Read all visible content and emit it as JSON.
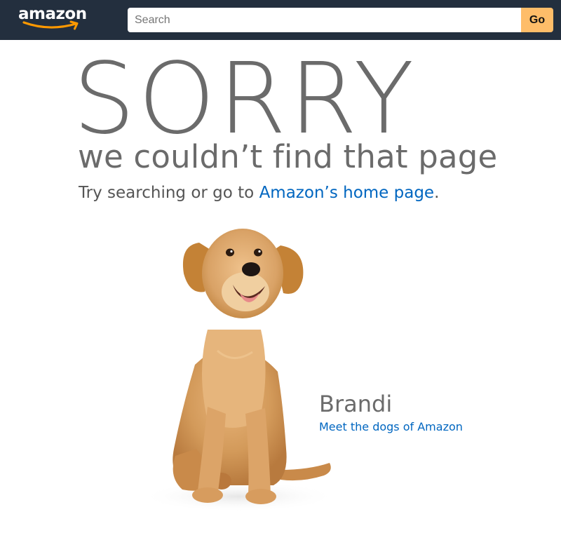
{
  "header": {
    "logo_text": "amazon",
    "search_placeholder": "Search",
    "go_label": "Go"
  },
  "error": {
    "headline": "SORRY",
    "subtitle": "we couldn’t find that page",
    "try_prefix": "Try searching or go to ",
    "home_link": "Amazon’s home page",
    "try_suffix": "."
  },
  "dog": {
    "name": "Brandi",
    "link": "Meet the dogs of Amazon"
  },
  "colors": {
    "header_bg": "#232f3e",
    "go_button": "#febd69",
    "link": "#0066c0",
    "text_gray": "#6b6b6b",
    "smile_orange": "#ff9900"
  },
  "icons": {
    "logo": "amazon-logo",
    "smile": "amazon-smile-arrow-icon"
  }
}
